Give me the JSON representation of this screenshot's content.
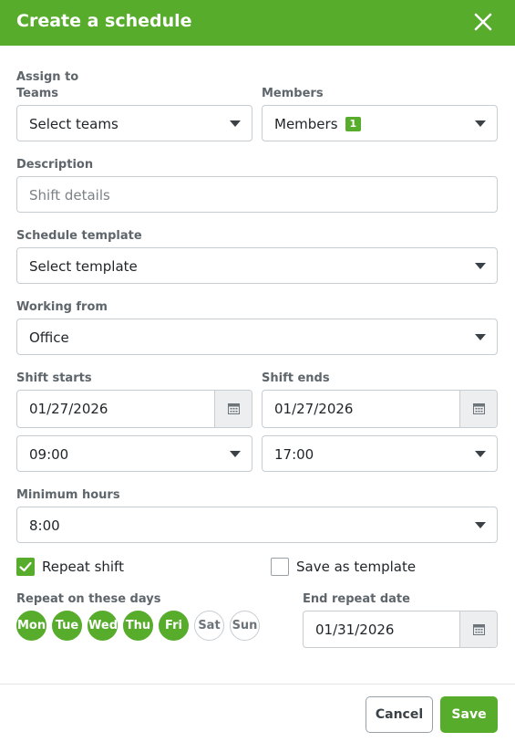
{
  "header": {
    "title": "Create a schedule",
    "close_icon": "close-icon"
  },
  "assign": {
    "section_label": "Assign to"
  },
  "teams": {
    "label": "Teams",
    "value": "Select teams"
  },
  "members": {
    "label": "Members",
    "value": "Members",
    "count": "1"
  },
  "description": {
    "label": "Description",
    "placeholder": "Shift details"
  },
  "template": {
    "label": "Schedule template",
    "value": "Select template"
  },
  "working_from": {
    "label": "Working from",
    "value": "Office"
  },
  "shift_starts": {
    "label": "Shift starts",
    "date": "01/27/2026",
    "time": "09:00"
  },
  "shift_ends": {
    "label": "Shift ends",
    "date": "01/27/2026",
    "time": "17:00"
  },
  "minimum_hours": {
    "label": "Minimum hours",
    "value": "8:00"
  },
  "repeat_shift": {
    "label": "Repeat shift",
    "checked": true
  },
  "save_template": {
    "label": "Save as template",
    "checked": false
  },
  "repeat_days": {
    "label": "Repeat on these days",
    "days": [
      {
        "label": "Mon",
        "selected": true
      },
      {
        "label": "Tue",
        "selected": true
      },
      {
        "label": "Wed",
        "selected": true
      },
      {
        "label": "Thu",
        "selected": true
      },
      {
        "label": "Fri",
        "selected": true
      },
      {
        "label": "Sat",
        "selected": false
      },
      {
        "label": "Sun",
        "selected": false
      }
    ]
  },
  "end_repeat": {
    "label": "End repeat date",
    "date": "01/31/2026"
  },
  "footer": {
    "cancel_label": "Cancel",
    "save_label": "Save"
  },
  "colors": {
    "accent": "#57ac2c",
    "border": "#c8cdd1",
    "label": "#5e656b"
  }
}
